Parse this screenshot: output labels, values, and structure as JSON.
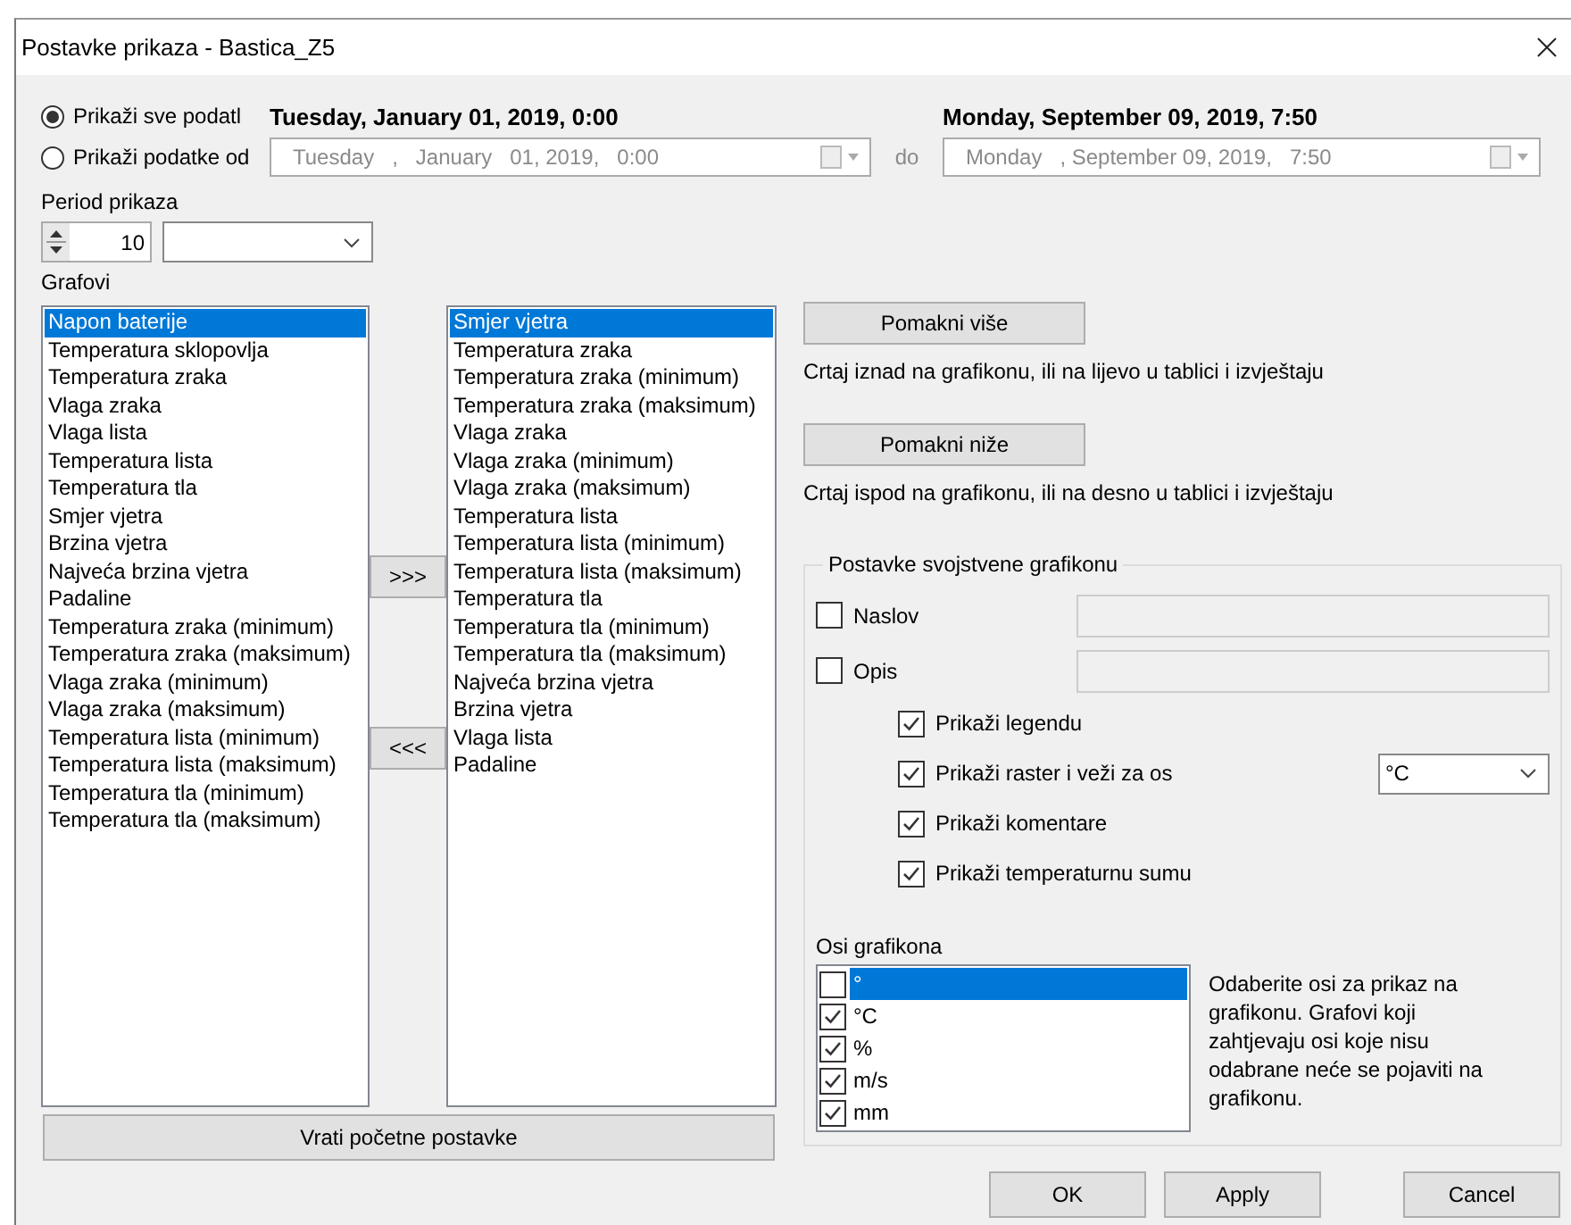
{
  "window": {
    "title": "Postavke prikaza - Bastica_Z5"
  },
  "range": {
    "options": [
      {
        "label": "Prikaži sve podatl",
        "selected": true
      },
      {
        "label": "Prikaži podatke od",
        "selected": false
      }
    ],
    "from_display": "Tuesday, January 01, 2019, 0:00",
    "to_display": "Monday, September 09, 2019, 7:50",
    "from_picker": {
      "value": "Tuesday   ,   January   01, 2019,   0:00",
      "disabled": true
    },
    "separator": "do",
    "to_picker": {
      "value": "Monday   , September 09, 2019,   7:50",
      "disabled": true
    }
  },
  "period": {
    "label": "Period prikaza",
    "value": "10"
  },
  "charts": {
    "label": "Grafovi",
    "available": [
      {
        "label": "Napon baterije",
        "selected": true
      },
      {
        "label": "Temperatura sklopovlja",
        "selected": false
      },
      {
        "label": "Temperatura zraka",
        "selected": false
      },
      {
        "label": "Vlaga zraka",
        "selected": false
      },
      {
        "label": "Vlaga lista",
        "selected": false
      },
      {
        "label": "Temperatura lista",
        "selected": false
      },
      {
        "label": "Temperatura tla",
        "selected": false
      },
      {
        "label": "Smjer vjetra",
        "selected": false
      },
      {
        "label": "Brzina vjetra",
        "selected": false
      },
      {
        "label": "Najveća brzina vjetra",
        "selected": false
      },
      {
        "label": "Padaline",
        "selected": false
      },
      {
        "label": "Temperatura zraka (minimum)",
        "selected": false
      },
      {
        "label": "Temperatura zraka (maksimum)",
        "selected": false
      },
      {
        "label": "Vlaga zraka (minimum)",
        "selected": false
      },
      {
        "label": "Vlaga zraka (maksimum)",
        "selected": false
      },
      {
        "label": "Temperatura lista (minimum)",
        "selected": false
      },
      {
        "label": "Temperatura lista (maksimum)",
        "selected": false
      },
      {
        "label": "Temperatura tla (minimum)",
        "selected": false
      },
      {
        "label": "Temperatura tla (maksimum)",
        "selected": false
      }
    ],
    "shown": [
      {
        "label": "Smjer vjetra",
        "selected": true
      },
      {
        "label": "Temperatura zraka",
        "selected": false
      },
      {
        "label": "Temperatura zraka (minimum)",
        "selected": false
      },
      {
        "label": "Temperatura zraka (maksimum)",
        "selected": false
      },
      {
        "label": "Vlaga zraka",
        "selected": false
      },
      {
        "label": "Vlaga zraka (minimum)",
        "selected": false
      },
      {
        "label": "Vlaga zraka (maksimum)",
        "selected": false
      },
      {
        "label": "Temperatura lista",
        "selected": false
      },
      {
        "label": "Temperatura lista (minimum)",
        "selected": false
      },
      {
        "label": "Temperatura lista (maksimum)",
        "selected": false
      },
      {
        "label": "Temperatura tla",
        "selected": false
      },
      {
        "label": "Temperatura tla (minimum)",
        "selected": false
      },
      {
        "label": "Temperatura tla (maksimum)",
        "selected": false
      },
      {
        "label": "Najveća brzina vjetra",
        "selected": false
      },
      {
        "label": "Brzina vjetra",
        "selected": false
      },
      {
        "label": "Vlaga lista",
        "selected": false
      },
      {
        "label": "Padaline",
        "selected": false
      }
    ],
    "add_button": ">>>",
    "remove_button": "<<<",
    "reset_button": "Vrati početne postavke"
  },
  "order": {
    "up_button": "Pomakni više",
    "up_hint": "Crtaj iznad na grafikonu, ili na lijevo u tablici i izvještaju",
    "down_button": "Pomakni niže",
    "down_hint": "Crtaj ispod na grafikonu, ili na desno u tablici i izvještaju"
  },
  "chart_settings": {
    "legend": "Postavke svojstvene grafikonu",
    "fields": [
      {
        "label": "Naslov",
        "checked": false
      },
      {
        "label": "Opis",
        "checked": false
      }
    ],
    "options": [
      {
        "label": "Prikaži legendu",
        "checked": true
      },
      {
        "label": "Prikaži raster i veži za os",
        "checked": true,
        "select_value": "°C"
      },
      {
        "label": "Prikaži komentare",
        "checked": true
      },
      {
        "label": "Prikaži temperaturnu sumu",
        "checked": true
      }
    ],
    "axes": {
      "label": "Osi grafikona",
      "items": [
        {
          "label": "°",
          "checked": false,
          "selected": true
        },
        {
          "label": "°C",
          "checked": true,
          "selected": false
        },
        {
          "label": "%",
          "checked": true,
          "selected": false
        },
        {
          "label": "m/s",
          "checked": true,
          "selected": false
        },
        {
          "label": "mm",
          "checked": true,
          "selected": false
        }
      ],
      "hint": "Odaberite osi za prikaz na grafikonu. Grafovi koji zahtjevaju osi koje nisu odabrane neće se pojaviti na grafikonu."
    }
  },
  "buttons": [
    "OK",
    "Apply",
    "Cancel"
  ]
}
